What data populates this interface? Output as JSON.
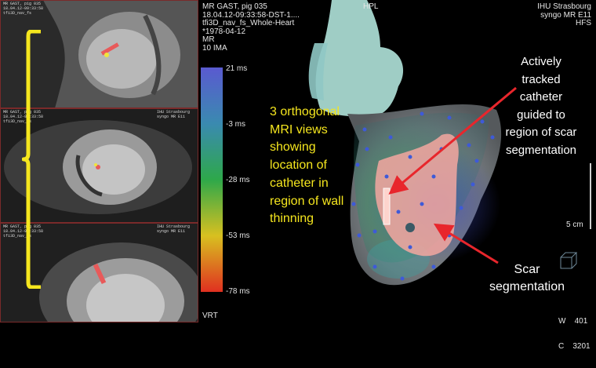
{
  "app": {
    "renderer": "VRT"
  },
  "header_left": {
    "patient": "MR GAST, pig 035",
    "datetime": "18.04.12-09:33:58-DST-1....",
    "series": "tfi3D_nav_fs_Whole-Heart",
    "dob": "*1978-04-12",
    "modality": "MR",
    "images": "10 IMA"
  },
  "header_center": {
    "orientation": "HPL"
  },
  "header_right": {
    "institution": "IHU Strasbourg",
    "software": "syngo MR E11",
    "position": "HFS"
  },
  "colorbar": {
    "ticks": [
      "21 ms",
      "-3 ms",
      "-28 ms",
      "-53 ms",
      "-78 ms"
    ],
    "colors": [
      "#5a5ad0",
      "#3a8ab0",
      "#2ea84a",
      "#d8c020",
      "#e03020"
    ]
  },
  "scale_bar": {
    "label": "5 cm"
  },
  "window": {
    "width_label": "W",
    "width_value": "401",
    "center_label": "C",
    "center_value": "3201"
  },
  "annotations": {
    "views_text": [
      "3 orthogonal",
      "MRI views",
      "showing",
      "location of",
      "catheter in",
      "region of wall",
      "thinning"
    ],
    "catheter_text": [
      "Actively",
      "tracked",
      "catheter",
      "guided to",
      "region of scar",
      "segmentation"
    ],
    "scar_text": [
      "Scar",
      "segmentation"
    ]
  },
  "mri_panels": [
    {
      "label_tl": "MR GAST, pig 035\n18.04.12-09:33:58\ntfi3D_nav_fs",
      "label_tr": "IHU Strasbourg\nsyngo MR E11"
    },
    {
      "label_tl": "MR GAST, pig 035\n18.04.12-09:33:58\ntfi3D_nav_fs",
      "label_tr": "IHU Strasbourg\nsyngo MR E11"
    },
    {
      "label_tl": "MR GAST, pig 035\n18.04.12-09:33:58\ntfi3D_nav_fs",
      "label_tr": "IHU Strasbourg\nsyngo MR E11"
    }
  ],
  "colors": {
    "highlight": "#f5e61e",
    "arrow": "#e8262c",
    "frame": "#7a2a2a"
  }
}
